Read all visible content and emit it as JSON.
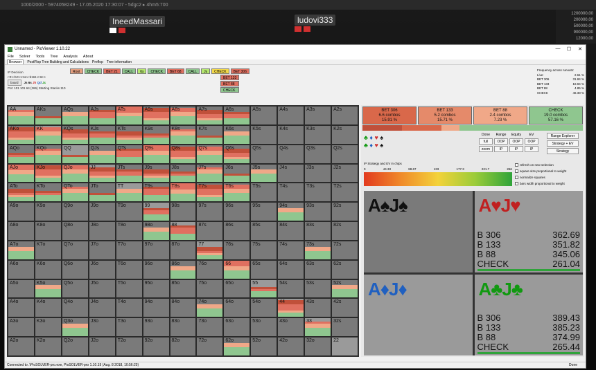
{
  "bg": {
    "topbar_text": "1000/2000 - 5974058249 - 17.05.2020 17:30:07 - 5dgc2 ▸ 4hm5:700",
    "players": [
      {
        "name": "IneedMassari"
      },
      {
        "name": "ludovi333"
      }
    ],
    "stacks": [
      "1200000,00",
      "200000,00",
      "500000,00",
      "900000,00",
      "12000,00"
    ]
  },
  "window": {
    "title": "Unnamed - PioViewer 1.10.22",
    "controls": [
      "—",
      "☐",
      "✕"
    ],
    "menu": [
      "File",
      "Solver",
      "Tools",
      "Tree",
      "Analysis",
      "About"
    ],
    "tabs": [
      "Browser",
      "PostFlop Tree Building and Calculations",
      "Preflop",
      "Tree information"
    ],
    "status_left": "Connected to .\\PioSOLVER-pro.exe, PioSOLVER-pro 1.10.19 (Aug. 8 2018, 10:56:25)",
    "status_right": "Done"
  },
  "info": {
    "decision": "IP Decision",
    "line": "r:0:c:b21:c:6s:c:b161:c:8c:c",
    "board_btn": "board",
    "board_cards": [
      {
        "t": "Js",
        "c": "#111"
      },
      {
        "t": "6s",
        "c": "#111"
      },
      {
        "t": "Jh",
        "c": "#d03030"
      },
      {
        "t": "Qd",
        "c": "#2060c0"
      },
      {
        "t": "Jc",
        "c": "#119911"
      }
    ],
    "pot": "Pot: 101 101 64 (266) Starting Stacks 110"
  },
  "tree": [
    {
      "label": "Root",
      "cls": "n-root"
    },
    {
      "label": "CHECK",
      "cls": "n-check"
    },
    {
      "label": "BET 21",
      "cls": "n-bet"
    },
    {
      "label": "CALL",
      "cls": "n-call"
    },
    {
      "label": "6s",
      "cls": "n-raise"
    },
    {
      "label": "CHECK",
      "cls": "n-check"
    },
    {
      "label": "BET 68",
      "cls": "n-bet"
    },
    {
      "label": "CALL",
      "cls": "n-call"
    },
    {
      "label": "Js",
      "cls": "n-raise"
    },
    {
      "label": "CHECK",
      "cls": "n-yellow"
    },
    {
      "label": "BET 306",
      "cls": "n-bet"
    }
  ],
  "subtree": [
    {
      "label": "BET 133",
      "cls": "n-bet"
    },
    {
      "label": "BET 88",
      "cls": "n-bet"
    },
    {
      "label": "CHECK",
      "cls": "n-check"
    }
  ],
  "freq": {
    "title": "Frequency across runouts:",
    "live_label": "Live:",
    "live_val": "2.61 %",
    "rows": [
      {
        "k": "BET 306",
        "v": "31.84 %"
      },
      {
        "k": "BET 133",
        "v": "18.94 %"
      },
      {
        "k": "BET 88",
        "v": "4.85 %"
      },
      {
        "k": "CHECK",
        "v": "46.33 %"
      }
    ]
  },
  "matrix": {
    "labels": [
      [
        "AA",
        "AKs",
        "AQs",
        "AJs",
        "ATs",
        "A9s",
        "A8s",
        "A7s",
        "A6s",
        "A5s",
        "A4s",
        "A3s",
        "A2s"
      ],
      [
        "AKo",
        "KK",
        "KQs",
        "KJs",
        "KTs",
        "K9s",
        "K8s",
        "K7s",
        "K6s",
        "K5s",
        "K4s",
        "K3s",
        "K2s"
      ],
      [
        "AQo",
        "KQo",
        "QQ",
        "QJs",
        "QTs",
        "Q9s",
        "Q8s",
        "Q7s",
        "Q6s",
        "Q5s",
        "Q4s",
        "Q3s",
        "Q2s"
      ],
      [
        "AJo",
        "KJo",
        "QJo",
        "JJ",
        "JTs",
        "J9s",
        "J8s",
        "J7s",
        "J6s",
        "J5s",
        "J4s",
        "J3s",
        "J2s"
      ],
      [
        "ATo",
        "KTo",
        "QTo",
        "JTo",
        "TT",
        "T9s",
        "T8s",
        "T7s",
        "T6s",
        "T5s",
        "T4s",
        "T3s",
        "T2s"
      ],
      [
        "A9o",
        "K9o",
        "Q9o",
        "J9o",
        "T9o",
        "99",
        "98s",
        "97s",
        "96s",
        "95s",
        "94s",
        "93s",
        "92s"
      ],
      [
        "A8o",
        "K8o",
        "Q8o",
        "J8o",
        "T8o",
        "98o",
        "88",
        "87s",
        "86s",
        "85s",
        "84s",
        "83s",
        "82s"
      ],
      [
        "A7o",
        "K7o",
        "Q7o",
        "J7o",
        "T7o",
        "97o",
        "87o",
        "77",
        "76s",
        "75s",
        "74s",
        "73s",
        "72s"
      ],
      [
        "A6o",
        "K6o",
        "Q6o",
        "J6o",
        "T6o",
        "96o",
        "86o",
        "76o",
        "66",
        "65s",
        "64s",
        "63s",
        "62s"
      ],
      [
        "A5o",
        "K5o",
        "Q5o",
        "J5o",
        "T5o",
        "95o",
        "85o",
        "75o",
        "65o",
        "55",
        "54s",
        "53s",
        "52s"
      ],
      [
        "A4o",
        "K4o",
        "Q4o",
        "J4o",
        "T4o",
        "94o",
        "84o",
        "74o",
        "64o",
        "54o",
        "44",
        "43s",
        "42s"
      ],
      [
        "A3o",
        "K3o",
        "Q3o",
        "J3o",
        "T3o",
        "93o",
        "83o",
        "73o",
        "63o",
        "53o",
        "43o",
        "33",
        "32s"
      ],
      [
        "A2o",
        "K2o",
        "Q2o",
        "J2o",
        "T2o",
        "92o",
        "82o",
        "72o",
        "62o",
        "52o",
        "42o",
        "32o",
        "22"
      ]
    ]
  },
  "actions": [
    {
      "name": "BET 306",
      "combos": "6.6 combos",
      "pct": "15.91 %",
      "color": "#d9684a"
    },
    {
      "name": "BET 133",
      "combos": "5.2 combos",
      "pct": "15.71 %",
      "color": "#e58a6a"
    },
    {
      "name": "BET 88",
      "combos": "2.4 combos",
      "pct": "7.23 %",
      "color": "#f0a888"
    },
    {
      "name": "CHECK",
      "combos": "19.0 combos",
      "pct": "57.16 %",
      "color": "#8fc68f"
    }
  ],
  "actbar": [
    {
      "frac": 0.18,
      "color": "#c0503a"
    },
    {
      "frac": 0.18,
      "color": "#d9684a"
    },
    {
      "frac": 0.08,
      "color": "#f0a888"
    },
    {
      "frac": 0.56,
      "color": "#8fc68f"
    }
  ],
  "suits": [
    [
      {
        "g": "♣",
        "c": "#119911"
      },
      {
        "g": "♦",
        "c": "#2060c0"
      },
      {
        "g": "♥",
        "c": "#d03030"
      },
      {
        "g": "♠",
        "c": "#111"
      }
    ],
    [
      {
        "g": "♣",
        "c": "#119911"
      },
      {
        "g": "♦",
        "c": "#2060c0"
      },
      {
        "g": "♥",
        "c": "#d03030"
      },
      {
        "g": "♠",
        "c": "#111"
      }
    ]
  ],
  "cols_head": [
    "Done",
    "Range",
    "Equity",
    "EV"
  ],
  "cols_btns": [
    "full",
    "OOP",
    "OOP",
    "OOP",
    "zoom",
    "IP",
    "IP",
    "IP"
  ],
  "rbtns": [
    "Range Explorer",
    "Strategy + EV",
    "Strategy"
  ],
  "ev_label": "IP Strategy and EV in chips",
  "scale": [
    "0",
    "44.33",
    "88.67",
    "133",
    "177.3",
    "221.7",
    "266"
  ],
  "checks": [
    "refresh on new selection",
    "square size proportional to weight",
    "normalize squares",
    "bars width proportional to weight"
  ],
  "combos": [
    {
      "hand": "A♠J♠",
      "color": "#111",
      "dim": true,
      "rows": []
    },
    {
      "hand": "A♥J♥",
      "color": "#c02020",
      "dim": false,
      "rows": [
        {
          "k": "B 306",
          "v": "362.69"
        },
        {
          "k": "B 133",
          "v": "351.82"
        },
        {
          "k": "B 88",
          "v": "345.06"
        },
        {
          "k": "CHECK",
          "v": "261.04"
        }
      ]
    },
    {
      "hand": "A♦J♦",
      "color": "#2060c0",
      "dim": false,
      "rows": []
    },
    {
      "hand": "A♣J♣",
      "color": "#119911",
      "dim": false,
      "rows": [
        {
          "k": "B 306",
          "v": "389.43"
        },
        {
          "k": "B 133",
          "v": "385.23"
        },
        {
          "k": "B 88",
          "v": "374.99"
        },
        {
          "k": "CHECK",
          "v": "265.44"
        }
      ]
    }
  ]
}
